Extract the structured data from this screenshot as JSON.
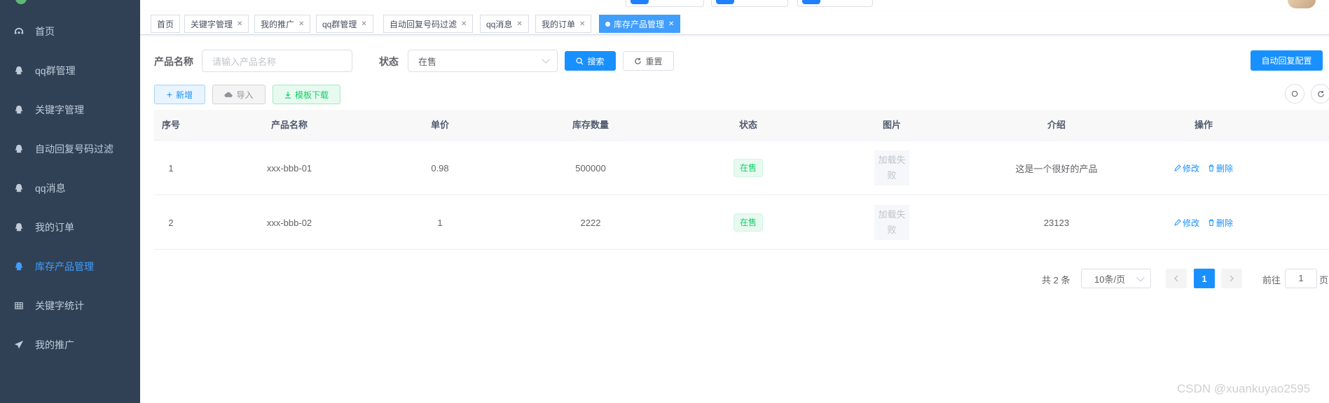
{
  "sidebar": {
    "items": [
      {
        "label": "首页",
        "icon": "dashboard-icon",
        "active": false
      },
      {
        "label": "qq群管理",
        "icon": "qq-icon",
        "active": false
      },
      {
        "label": "关键字管理",
        "icon": "qq-icon",
        "active": false
      },
      {
        "label": "自动回复号码过滤",
        "icon": "qq-icon",
        "active": false
      },
      {
        "label": "qq消息",
        "icon": "qq-icon",
        "active": false
      },
      {
        "label": "我的订单",
        "icon": "qq-icon",
        "active": false
      },
      {
        "label": "库存产品管理",
        "icon": "qq-icon",
        "active": true
      },
      {
        "label": "关键字统计",
        "icon": "table-icon",
        "active": false
      },
      {
        "label": "我的推广",
        "icon": "send-icon",
        "active": false
      }
    ]
  },
  "tags": [
    {
      "label": "首页",
      "closable": false
    },
    {
      "label": "关键字管理",
      "closable": true
    },
    {
      "label": "我的推广",
      "closable": true
    },
    {
      "label": "qq群管理",
      "closable": true
    },
    {
      "label": "自动回复号码过滤",
      "closable": true
    },
    {
      "label": "qq消息",
      "closable": true
    },
    {
      "label": "我的订单",
      "closable": true
    },
    {
      "label": "库存产品管理",
      "closable": true,
      "active": true
    }
  ],
  "search": {
    "name_label": "产品名称",
    "name_placeholder": "请输入产品名称",
    "status_label": "状态",
    "status_value": "在售",
    "search_btn": "搜索",
    "reset_btn": "重置",
    "auto_reply_btn": "自动回复配置"
  },
  "toolbar": {
    "add_btn": "新增",
    "import_btn": "导入",
    "template_btn": "模板下载"
  },
  "table": {
    "columns": [
      "序号",
      "产品名称",
      "单价",
      "库存数量",
      "状态",
      "图片",
      "介绍",
      "操作"
    ],
    "rows": [
      {
        "index": "1",
        "name": "xxx-bbb-01",
        "price": "0.98",
        "stock": "500000",
        "status": "在售",
        "image": "加载失败",
        "intro": "这是一个很好的产品"
      },
      {
        "index": "2",
        "name": "xxx-bbb-02",
        "price": "1",
        "stock": "2222",
        "status": "在售",
        "image": "加载失败",
        "intro": "23123"
      }
    ],
    "edit_label": "修改",
    "delete_label": "删除",
    "image_fail_line1": "加载失",
    "image_fail_line2": "败"
  },
  "pagination": {
    "total": "共 2 条",
    "page_size": "10条/页",
    "current_page": "1",
    "goto_label": "前往",
    "goto_value": "1",
    "page_unit": "页"
  },
  "watermark": "CSDN @xuankuyao2595",
  "colors": {
    "sidebar_bg": "#304156",
    "sidebar_text": "#bfcbd9",
    "accent": "#1890ff",
    "success": "#13ce66"
  }
}
